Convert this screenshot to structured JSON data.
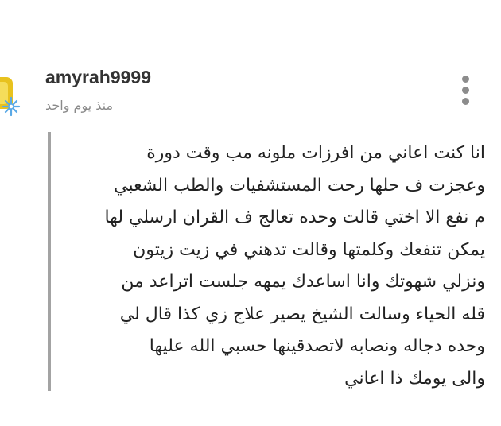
{
  "comment": {
    "username": "amyrah9999",
    "timestamp": "منذ يوم واحد",
    "avatar_icon": "snowflake-crest-avatar",
    "more_icon": "more-vertical-icon",
    "lines": [
      "انا كنت اعاني من افرزات ملونه مب وقت دورة",
      "وعجزت ف حلها رحت المستشفيات والطب الشعبي",
      "م نفع الا اختي قالت وحده تعالج ف القران ارسلي لها",
      "يمكن تنفعك وكلمتها وقالت تدهني في زيت زيتون",
      "ونزلي شهوتك وانا اساعدك يمهه جلست اتراعد من",
      "قله الحياء وسالت الشيخ يصير علاج زي كذا قال لي",
      "وحده دجاله ونصابه لاتصدقينها حسبي الله عليها",
      "والى يومك ذا اعاني"
    ]
  },
  "colors": {
    "username": "#333333",
    "timestamp": "#8a8a8a",
    "quote_bar": "#a3a3a3",
    "avatar_gold": "#e8c21e",
    "snowflake": "#5aa9e6"
  }
}
